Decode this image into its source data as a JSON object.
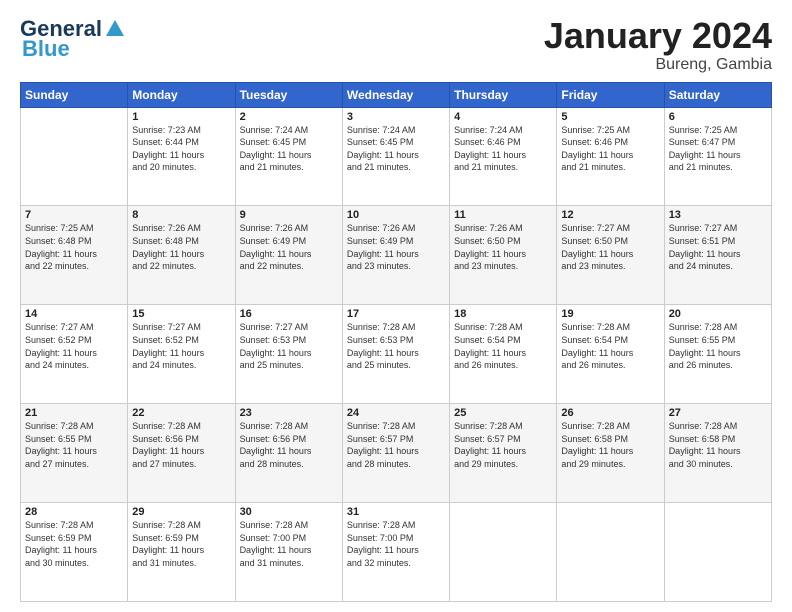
{
  "logo": {
    "line1": "General",
    "line2": "Blue"
  },
  "title": "January 2024",
  "subtitle": "Bureng, Gambia",
  "days_of_week": [
    "Sunday",
    "Monday",
    "Tuesday",
    "Wednesday",
    "Thursday",
    "Friday",
    "Saturday"
  ],
  "weeks": [
    [
      {
        "day": "",
        "info": ""
      },
      {
        "day": "1",
        "info": "Sunrise: 7:23 AM\nSunset: 6:44 PM\nDaylight: 11 hours\nand 20 minutes."
      },
      {
        "day": "2",
        "info": "Sunrise: 7:24 AM\nSunset: 6:45 PM\nDaylight: 11 hours\nand 21 minutes."
      },
      {
        "day": "3",
        "info": "Sunrise: 7:24 AM\nSunset: 6:45 PM\nDaylight: 11 hours\nand 21 minutes."
      },
      {
        "day": "4",
        "info": "Sunrise: 7:24 AM\nSunset: 6:46 PM\nDaylight: 11 hours\nand 21 minutes."
      },
      {
        "day": "5",
        "info": "Sunrise: 7:25 AM\nSunset: 6:46 PM\nDaylight: 11 hours\nand 21 minutes."
      },
      {
        "day": "6",
        "info": "Sunrise: 7:25 AM\nSunset: 6:47 PM\nDaylight: 11 hours\nand 21 minutes."
      }
    ],
    [
      {
        "day": "7",
        "info": "Sunrise: 7:25 AM\nSunset: 6:48 PM\nDaylight: 11 hours\nand 22 minutes."
      },
      {
        "day": "8",
        "info": "Sunrise: 7:26 AM\nSunset: 6:48 PM\nDaylight: 11 hours\nand 22 minutes."
      },
      {
        "day": "9",
        "info": "Sunrise: 7:26 AM\nSunset: 6:49 PM\nDaylight: 11 hours\nand 22 minutes."
      },
      {
        "day": "10",
        "info": "Sunrise: 7:26 AM\nSunset: 6:49 PM\nDaylight: 11 hours\nand 23 minutes."
      },
      {
        "day": "11",
        "info": "Sunrise: 7:26 AM\nSunset: 6:50 PM\nDaylight: 11 hours\nand 23 minutes."
      },
      {
        "day": "12",
        "info": "Sunrise: 7:27 AM\nSunset: 6:50 PM\nDaylight: 11 hours\nand 23 minutes."
      },
      {
        "day": "13",
        "info": "Sunrise: 7:27 AM\nSunset: 6:51 PM\nDaylight: 11 hours\nand 24 minutes."
      }
    ],
    [
      {
        "day": "14",
        "info": "Sunrise: 7:27 AM\nSunset: 6:52 PM\nDaylight: 11 hours\nand 24 minutes."
      },
      {
        "day": "15",
        "info": "Sunrise: 7:27 AM\nSunset: 6:52 PM\nDaylight: 11 hours\nand 24 minutes."
      },
      {
        "day": "16",
        "info": "Sunrise: 7:27 AM\nSunset: 6:53 PM\nDaylight: 11 hours\nand 25 minutes."
      },
      {
        "day": "17",
        "info": "Sunrise: 7:28 AM\nSunset: 6:53 PM\nDaylight: 11 hours\nand 25 minutes."
      },
      {
        "day": "18",
        "info": "Sunrise: 7:28 AM\nSunset: 6:54 PM\nDaylight: 11 hours\nand 26 minutes."
      },
      {
        "day": "19",
        "info": "Sunrise: 7:28 AM\nSunset: 6:54 PM\nDaylight: 11 hours\nand 26 minutes."
      },
      {
        "day": "20",
        "info": "Sunrise: 7:28 AM\nSunset: 6:55 PM\nDaylight: 11 hours\nand 26 minutes."
      }
    ],
    [
      {
        "day": "21",
        "info": "Sunrise: 7:28 AM\nSunset: 6:55 PM\nDaylight: 11 hours\nand 27 minutes."
      },
      {
        "day": "22",
        "info": "Sunrise: 7:28 AM\nSunset: 6:56 PM\nDaylight: 11 hours\nand 27 minutes."
      },
      {
        "day": "23",
        "info": "Sunrise: 7:28 AM\nSunset: 6:56 PM\nDaylight: 11 hours\nand 28 minutes."
      },
      {
        "day": "24",
        "info": "Sunrise: 7:28 AM\nSunset: 6:57 PM\nDaylight: 11 hours\nand 28 minutes."
      },
      {
        "day": "25",
        "info": "Sunrise: 7:28 AM\nSunset: 6:57 PM\nDaylight: 11 hours\nand 29 minutes."
      },
      {
        "day": "26",
        "info": "Sunrise: 7:28 AM\nSunset: 6:58 PM\nDaylight: 11 hours\nand 29 minutes."
      },
      {
        "day": "27",
        "info": "Sunrise: 7:28 AM\nSunset: 6:58 PM\nDaylight: 11 hours\nand 30 minutes."
      }
    ],
    [
      {
        "day": "28",
        "info": "Sunrise: 7:28 AM\nSunset: 6:59 PM\nDaylight: 11 hours\nand 30 minutes."
      },
      {
        "day": "29",
        "info": "Sunrise: 7:28 AM\nSunset: 6:59 PM\nDaylight: 11 hours\nand 31 minutes."
      },
      {
        "day": "30",
        "info": "Sunrise: 7:28 AM\nSunset: 7:00 PM\nDaylight: 11 hours\nand 31 minutes."
      },
      {
        "day": "31",
        "info": "Sunrise: 7:28 AM\nSunset: 7:00 PM\nDaylight: 11 hours\nand 32 minutes."
      },
      {
        "day": "",
        "info": ""
      },
      {
        "day": "",
        "info": ""
      },
      {
        "day": "",
        "info": ""
      }
    ]
  ]
}
